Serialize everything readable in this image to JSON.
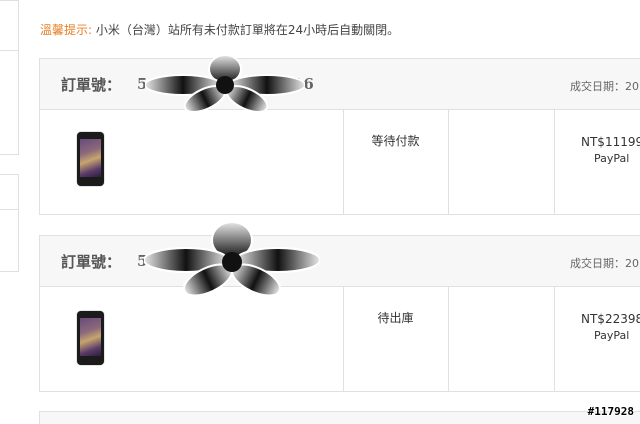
{
  "notice": {
    "label": "溫馨提示:",
    "text": "小米（台灣）站所有未付款訂單將在24小時后自動關閉。"
  },
  "orders": [
    {
      "order_no_label": "訂單號：",
      "order_no_value": "5",
      "order_no_tail": "26",
      "date_label": "成交日期：20",
      "status": "等待付款",
      "price": "NT$11199",
      "payment": "PayPal"
    },
    {
      "order_no_label": "訂單號：",
      "order_no_value": "5",
      "order_no_tail": "",
      "date_label": "成交日期：20",
      "status": "待出庫",
      "price": "NT$22398",
      "payment": "PayPal"
    }
  ],
  "watermark": "#117928"
}
